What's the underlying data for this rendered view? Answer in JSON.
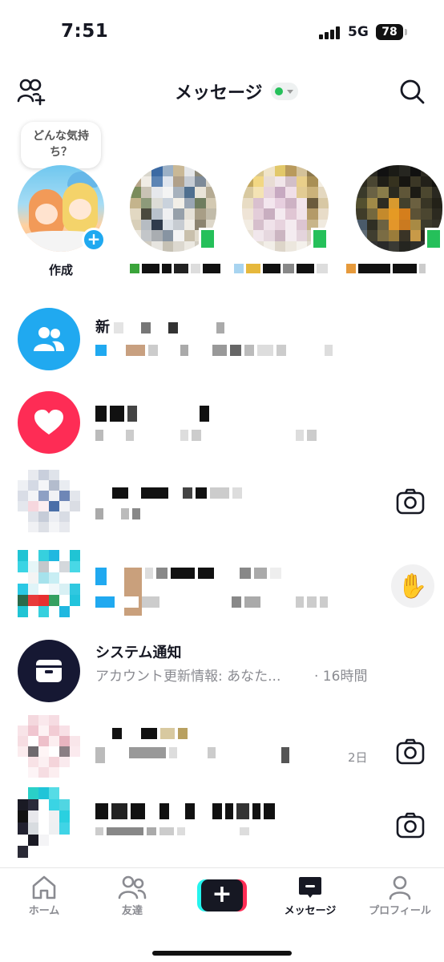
{
  "status_bar": {
    "time": "7:51",
    "network": "5G",
    "battery": "78"
  },
  "header": {
    "title": "メッセージ",
    "online_status_color": "#25c05a"
  },
  "stories": {
    "prompt_bubble": "どんな気持ち？",
    "create_label": "作成"
  },
  "chats": [
    {
      "title": "新",
      "kind": "group"
    },
    {
      "title": "",
      "kind": "likes"
    },
    {
      "title": "",
      "kind": "dm",
      "action": "camera-icon"
    },
    {
      "title": "",
      "kind": "dm",
      "action": "wave-emoji"
    },
    {
      "title": "システム通知",
      "subtitle": "アカウント更新情報: あなた...",
      "time": "· 16時間",
      "kind": "system"
    },
    {
      "title": "",
      "time": "2日",
      "kind": "dm",
      "action": "camera-icon"
    },
    {
      "title": "",
      "kind": "dm",
      "action": "camera-icon"
    }
  ],
  "bottom_nav": {
    "home": "ホーム",
    "friends": "友達",
    "messages": "メッセージ",
    "profile": "プロフィール"
  },
  "colors": {
    "accent_blue": "#20a9f0",
    "likes_pink": "#fe2c55",
    "system_navy": "#161833",
    "online_green": "#25c05a"
  }
}
